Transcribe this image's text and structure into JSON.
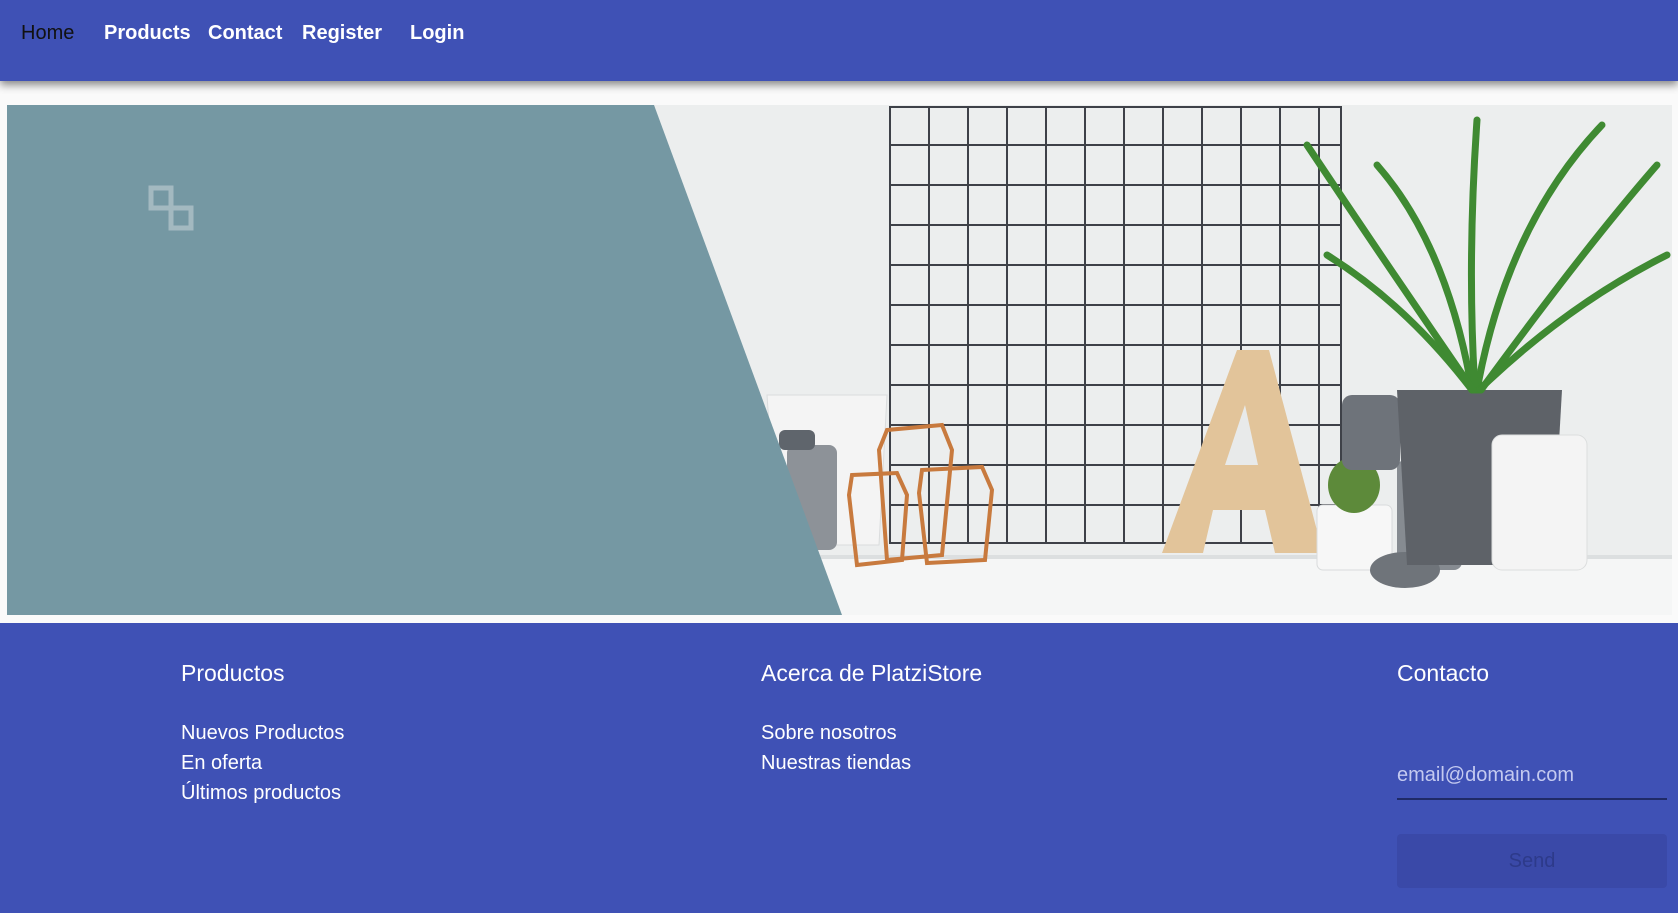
{
  "nav": {
    "home": "Home",
    "products": "Products",
    "contact": "Contact",
    "register": "Register",
    "login": "Login"
  },
  "hero": {
    "image_alt": "banner",
    "panel_color": "#7598a3",
    "logo_icon": "store-logo-icon"
  },
  "footer": {
    "products": {
      "title": "Productos",
      "links": [
        "Nuevos Productos",
        "En oferta",
        "Últimos productos"
      ]
    },
    "about": {
      "title": "Acerca de PlatziStore",
      "links": [
        "Sobre nosotros",
        "Nuestras tiendas"
      ]
    },
    "contact": {
      "title": "Contacto",
      "email_placeholder": "email@domain.com",
      "email_value": "",
      "send_label": "Send"
    }
  },
  "colors": {
    "primary": "#3f51b5",
    "panel": "#7598a3"
  }
}
